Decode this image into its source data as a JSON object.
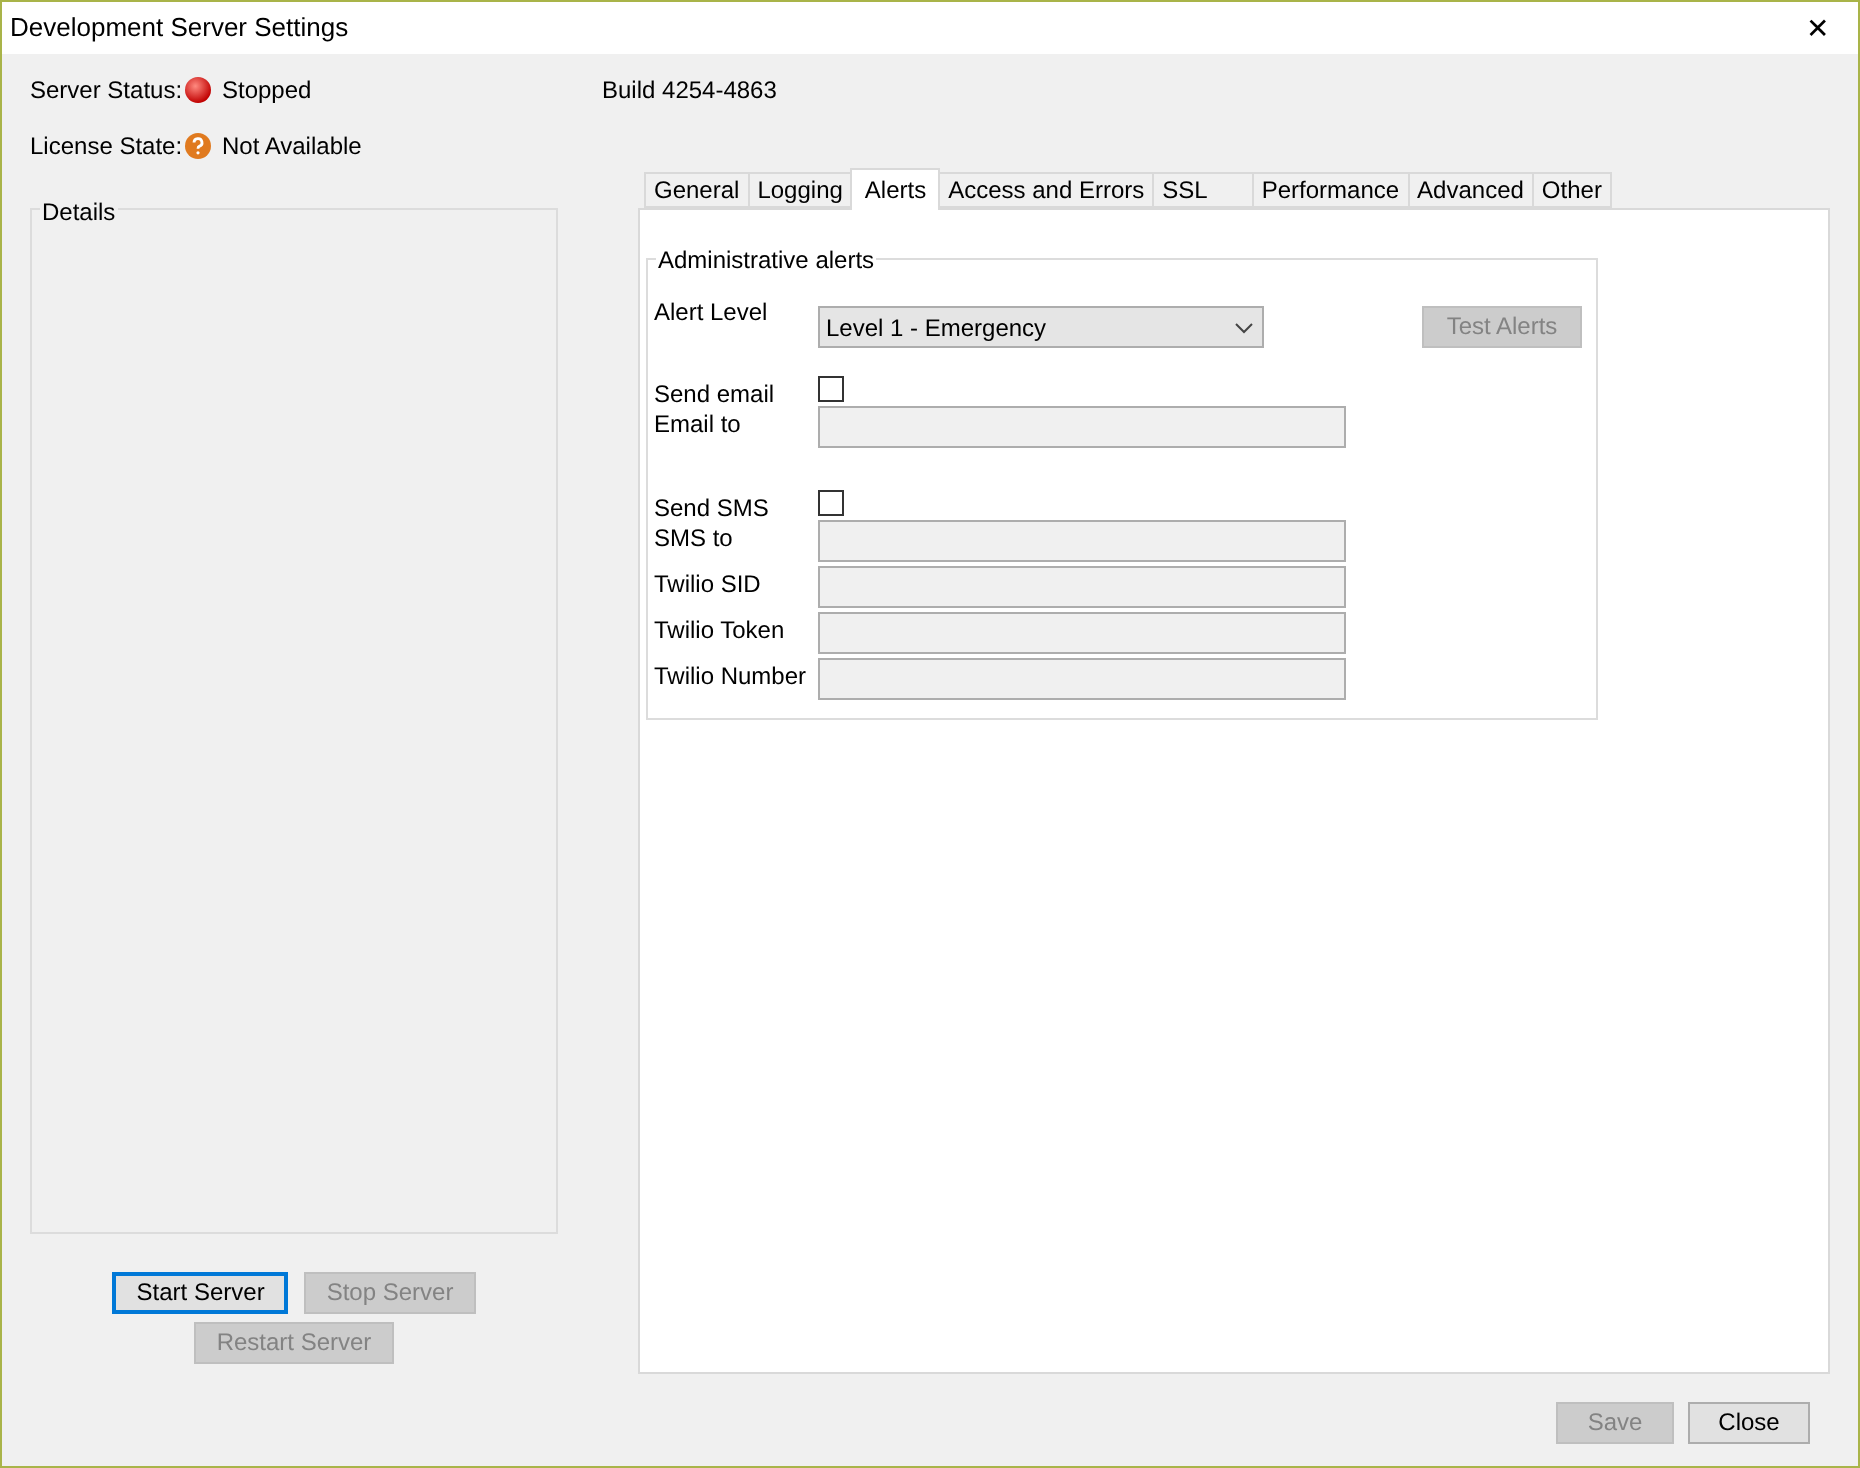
{
  "window": {
    "title": "Development Server Settings",
    "close": "✕"
  },
  "status": [
    {
      "label": "Server Status:",
      "value": "Stopped",
      "kind": "error"
    },
    {
      "label": "License State:",
      "value": "Not Available",
      "kind": "unknown"
    }
  ],
  "build": "Build 4254-4863",
  "details": {
    "title": "Details"
  },
  "server_buttons": [
    {
      "label": "Start Server",
      "disabled": false,
      "focused": true
    },
    {
      "label": "Stop Server",
      "disabled": true,
      "focused": false
    },
    {
      "label": "Restart Server",
      "disabled": true,
      "focused": false
    }
  ],
  "tabs": [
    {
      "label": "General",
      "selected": false
    },
    {
      "label": "Logging",
      "selected": false
    },
    {
      "label": "Alerts",
      "selected": true
    },
    {
      "label": "Access and Errors",
      "selected": false
    },
    {
      "label": "SSL",
      "selected": false
    },
    {
      "label": "Performance",
      "selected": false
    },
    {
      "label": "Advanced",
      "selected": false
    },
    {
      "label": "Other",
      "selected": false
    }
  ],
  "alerts": {
    "title": "Administrative alerts",
    "alert_level": {
      "label": "Alert Level",
      "value": "Level 1 - Emergency"
    },
    "test_button": {
      "label": "Test Alerts",
      "disabled": true
    },
    "rows": [
      {
        "kind": "checkbox",
        "label": "Send email",
        "checked": false
      },
      {
        "kind": "field",
        "label": "Email to",
        "disabled": true
      },
      {
        "kind": "gap"
      },
      {
        "kind": "checkbox",
        "label": "Send SMS",
        "checked": false
      },
      {
        "kind": "field",
        "label": "SMS to",
        "disabled": true
      },
      {
        "kind": "field",
        "label": "Twilio SID",
        "disabled": true
      },
      {
        "kind": "field",
        "label": "Twilio Token",
        "disabled": true
      },
      {
        "kind": "field",
        "label": "Twilio Number",
        "disabled": true
      }
    ]
  },
  "footer_buttons": [
    {
      "label": "Save",
      "disabled": true
    },
    {
      "label": "Close",
      "disabled": false
    }
  ]
}
